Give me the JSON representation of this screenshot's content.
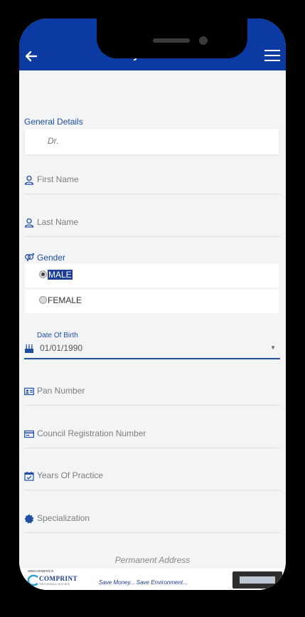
{
  "header": {
    "title": "My Profile"
  },
  "general": {
    "section_title": "General Details",
    "salutation": "Dr."
  },
  "fields": {
    "first_name": "First Name",
    "last_name": "Last Name"
  },
  "gender": {
    "label": "Gender",
    "options": [
      {
        "label": "MALE",
        "selected": true
      },
      {
        "label": "FEMALE",
        "selected": false
      }
    ]
  },
  "dob": {
    "label": "Date Of Birth",
    "value": "01/01/1990"
  },
  "more_fields": {
    "pan": "Pan Number",
    "council": "Council Registration Number",
    "years": "Years Of Practice",
    "specialization": "Specialization"
  },
  "address": {
    "label": "Permanent Address"
  },
  "ad": {
    "url": "www.comprint.in",
    "brand": "COMPRINT",
    "brand_sub": "TECHNOLOGIES",
    "tagline": "Save Money... Save Environment..."
  },
  "colors": {
    "header": "#0b3aa3",
    "accent": "#1f4fa3"
  }
}
